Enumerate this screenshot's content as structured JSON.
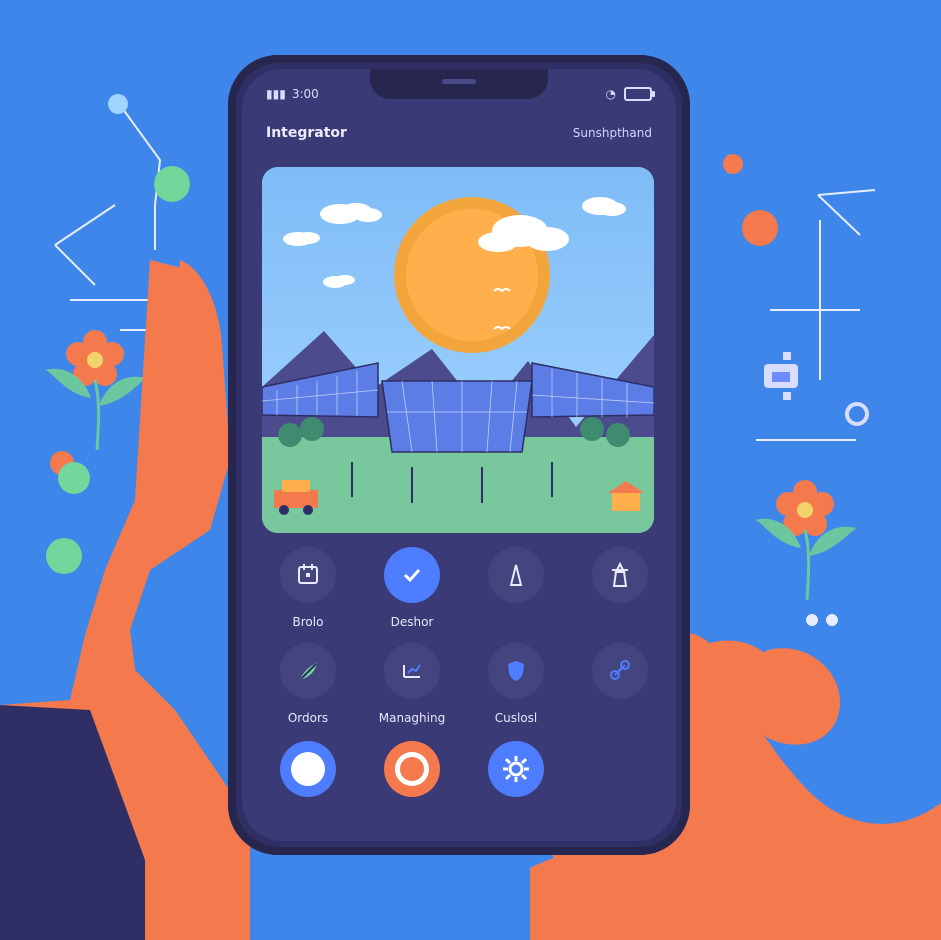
{
  "status_bar": {
    "time": "3:00"
  },
  "app": {
    "title": "Integrator",
    "top_right": "Sunshpthand"
  },
  "apps": [
    {
      "label": "Brolo",
      "icon": "calendar-icon"
    },
    {
      "label": "Deshor",
      "icon": "check-icon"
    },
    {
      "label": "",
      "icon": "tower-icon"
    },
    {
      "label": "",
      "icon": "transmission-icon"
    },
    {
      "label": "Ordors",
      "icon": "leaf-icon"
    },
    {
      "label": "Managhing",
      "icon": "chart-icon"
    },
    {
      "label": "Cuslosl",
      "icon": "shield-icon"
    },
    {
      "label": "",
      "icon": "link-icon"
    },
    {
      "label": "",
      "icon": "circle-icon"
    },
    {
      "label": "",
      "icon": "ring-icon"
    },
    {
      "label": "",
      "icon": "settings-icon"
    },
    {
      "label": "",
      "icon": "blank-icon"
    }
  ],
  "colors": {
    "accent": "#4e7dff",
    "hand": "#f47a4d",
    "bg": "#3f86ea"
  }
}
